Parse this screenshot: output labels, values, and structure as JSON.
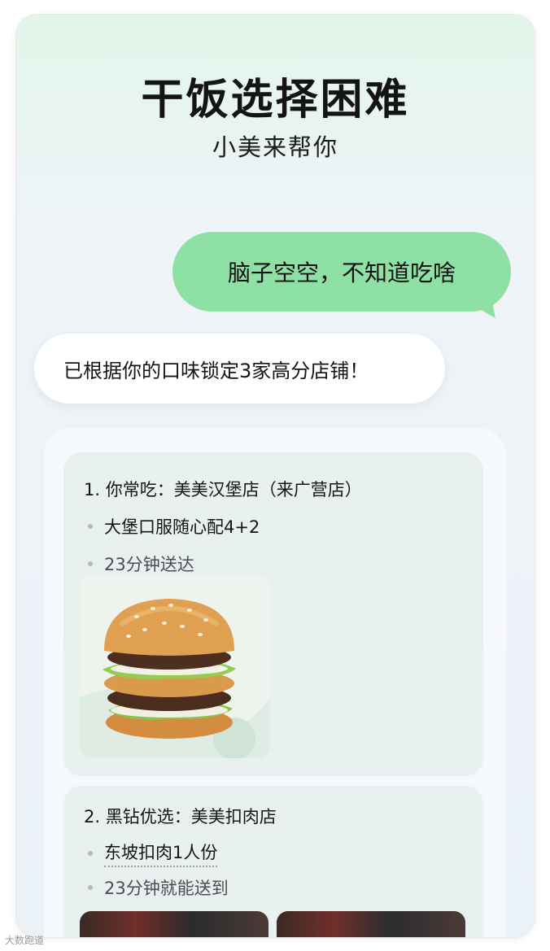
{
  "header": {
    "title": "干饭选择困难",
    "subtitle": "小美来帮你"
  },
  "chat": {
    "user_message": "脑子空空，不知道吃啥",
    "bot_message": "已根据你的口味锁定3家高分店铺！"
  },
  "stores": [
    {
      "title": "1. 你常吃：美美汉堡店（来广营店）",
      "item": "大堡口服随心配4+2",
      "delivery": "23分钟送达",
      "image": "burger-image"
    },
    {
      "title": "2. 黑钻优选：美美扣肉店",
      "item": "东坡扣肉1人份",
      "delivery": "23分钟就能送到",
      "image": "braised-pork-image"
    }
  ],
  "watermark": "大数跑道",
  "colors": {
    "user_bubble": "#8fe0a4",
    "card_bg": "#e9f1f0"
  }
}
